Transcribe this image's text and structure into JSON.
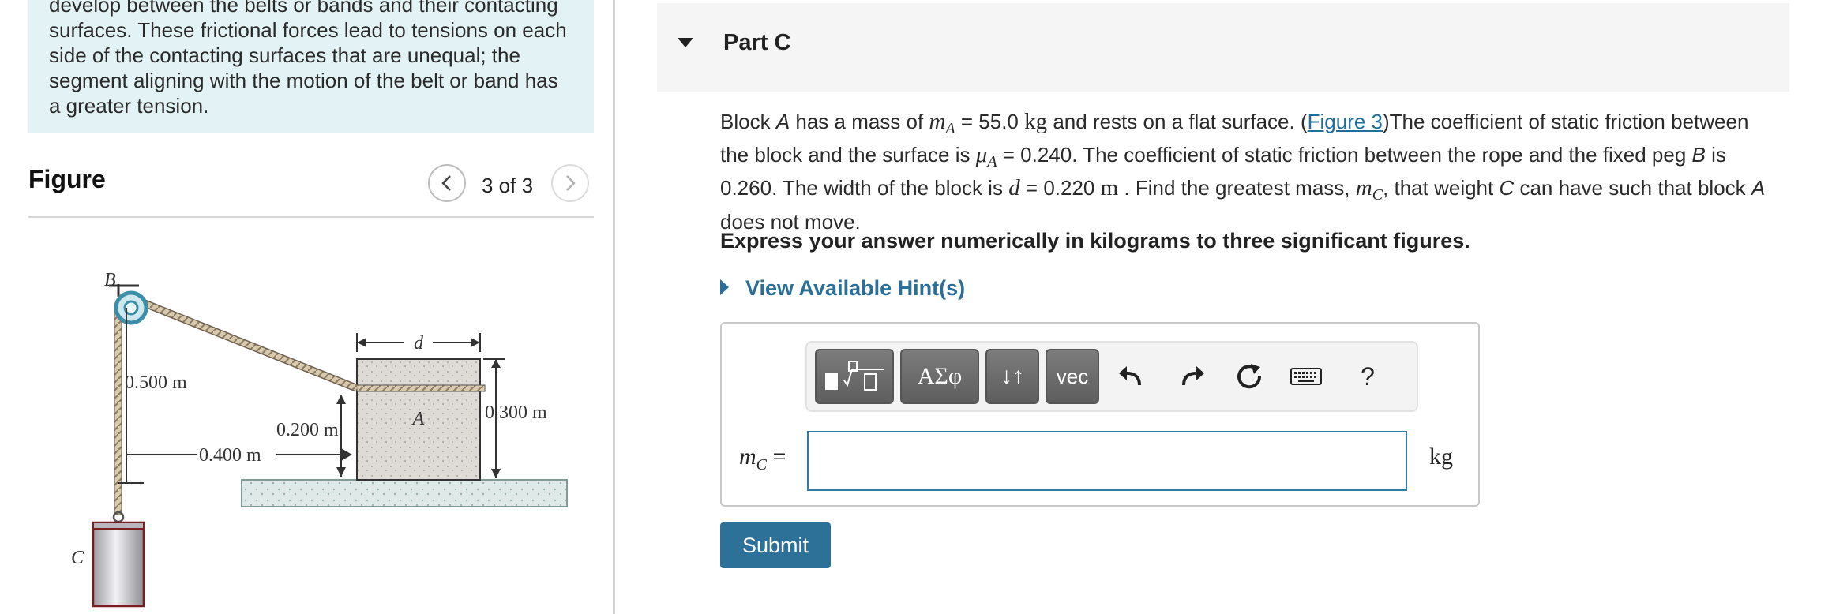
{
  "intro": {
    "lines": [
      "develop between the belts or bands and their contacting",
      "surfaces. These frictional forces lead to tensions on each",
      "side of the contacting surfaces that are unequal; the",
      "segment aligning with the motion of the belt or band has",
      "a greater tension."
    ]
  },
  "figure": {
    "title": "Figure",
    "counter": "3 of 3",
    "labels": {
      "peg": "B",
      "weight": "C",
      "block": "A",
      "width": "d",
      "h_rope": "0.500 m",
      "h_anchor": "0.200 m",
      "h_block": "0.300 m",
      "dist": "0.400 m"
    }
  },
  "part": {
    "title": "Part C"
  },
  "problem": {
    "l1_a": "Block ",
    "l1_A": "A",
    "l1_b": " has a mass of ",
    "l1_mA": "m",
    "l1_mA_sub": "A",
    "l1_c": " = 55.0 ",
    "l1_unit": "kg",
    "l1_d": " and rests on a flat surface. (",
    "l1_link": "Figure 3",
    "l1_e": ")The coefficient of static friction between",
    "l2_a": "the block and the surface is ",
    "l2_mu": "μ",
    "l2_mu_sub": "A",
    "l2_b": " = 0.240. The coefficient of static friction between the rope and the fixed peg ",
    "l2_B": "B",
    "l2_c": " is",
    "l3_a": "0.260. The width of the block is ",
    "l3_d": "d",
    "l3_b": " = 0.220 ",
    "l3_unit": "m",
    "l3_c": " . Find the greatest mass, ",
    "l3_mC": "m",
    "l3_mC_sub": "C",
    "l3_e": ", that weight ",
    "l3_C": "C",
    "l3_f": " can have such that block ",
    "l3_A": "A",
    "l4": "does not move."
  },
  "instruction": "Express your answer numerically in kilograms to three significant figures.",
  "hint": {
    "label": "View Available Hint(s)"
  },
  "toolbar": {
    "greek": "ΑΣφ",
    "arrows": "↓↑",
    "vec": "vec",
    "help": "?"
  },
  "answer": {
    "var": "m",
    "var_sub": "C",
    "eq": " =",
    "value": "",
    "unit": "kg"
  },
  "submit": {
    "label": "Submit"
  }
}
